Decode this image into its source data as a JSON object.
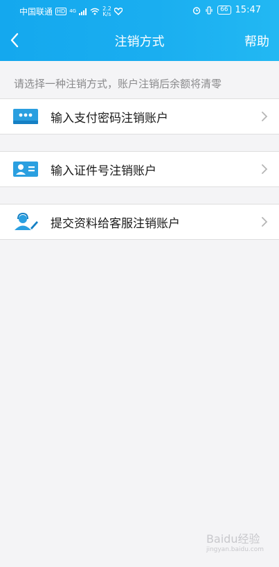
{
  "status_bar": {
    "carrier": "中国联通",
    "hd": "HD",
    "network": "4G",
    "speed_value": "2.2",
    "speed_unit": "K/s",
    "battery": "66",
    "time": "15:47"
  },
  "navbar": {
    "title": "注销方式",
    "help_label": "帮助"
  },
  "hint_text": "请选择一种注销方式，账户注销后余额将清零",
  "options": [
    {
      "label": "输入支付密码注销账户",
      "icon": "password-dots-icon"
    },
    {
      "label": "输入证件号注销账户",
      "icon": "id-card-icon"
    },
    {
      "label": "提交资料给客服注销账户",
      "icon": "customer-service-icon"
    }
  ],
  "watermark": {
    "brand": "Baidu经验",
    "url": "jingyan.baidu.com"
  },
  "colors": {
    "accent": "#1aaef0",
    "icon_blue": "#2a9fe0",
    "background": "#f4f4f6"
  }
}
